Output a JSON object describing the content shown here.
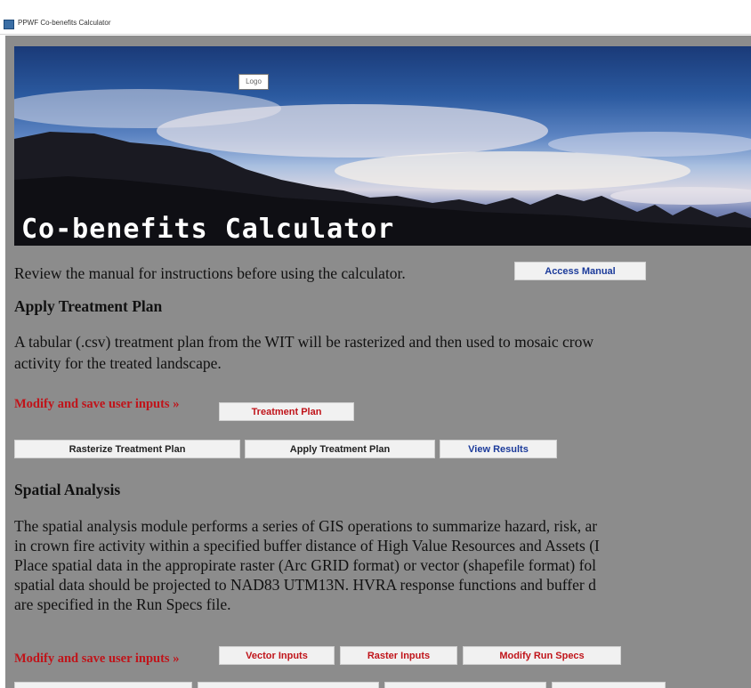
{
  "window": {
    "title": "PPWF Co-benefits Calculator"
  },
  "banner": {
    "logo_text": "Logo",
    "title": "Co-benefits Calculator"
  },
  "intro": {
    "text": "Review the manual for instructions before using the calculator.",
    "manual_button": "Access Manual"
  },
  "treatment": {
    "heading": "Apply Treatment Plan",
    "description_lines": [
      "A tabular (.csv) treatment plan from the WIT will be rasterized and then used to mosaic crow",
      "activity for the treated landscape."
    ],
    "modify_label": "Modify and save user inputs »",
    "treatment_plan_button": "Treatment Plan",
    "rasterize_button": "Rasterize Treatment Plan",
    "apply_button": "Apply Treatment Plan",
    "view_results_button": "View Results"
  },
  "spatial": {
    "heading": "Spatial Analysis",
    "description_lines": [
      "The spatial analysis module performs a series of GIS operations to summarize hazard, risk, ar",
      "in crown fire activity within a specified buffer distance of High Value Resources and Assets (I",
      "Place spatial data in the appropirate raster (Arc GRID format) or vector (shapefile format) fol",
      "spatial data should be projected to NAD83 UTM13N. HVRA response functions and buffer d",
      "are specified in the Run Specs file."
    ],
    "modify_label": "Modify and save user inputs »",
    "vector_button": "Vector Inputs",
    "raster_button": "Raster Inputs",
    "run_specs_button": "Modify Run Specs"
  },
  "colors": {
    "panel_gray": "#8c8c8c",
    "accent_red": "#c0141a",
    "link_blue": "#1b3a9a"
  }
}
